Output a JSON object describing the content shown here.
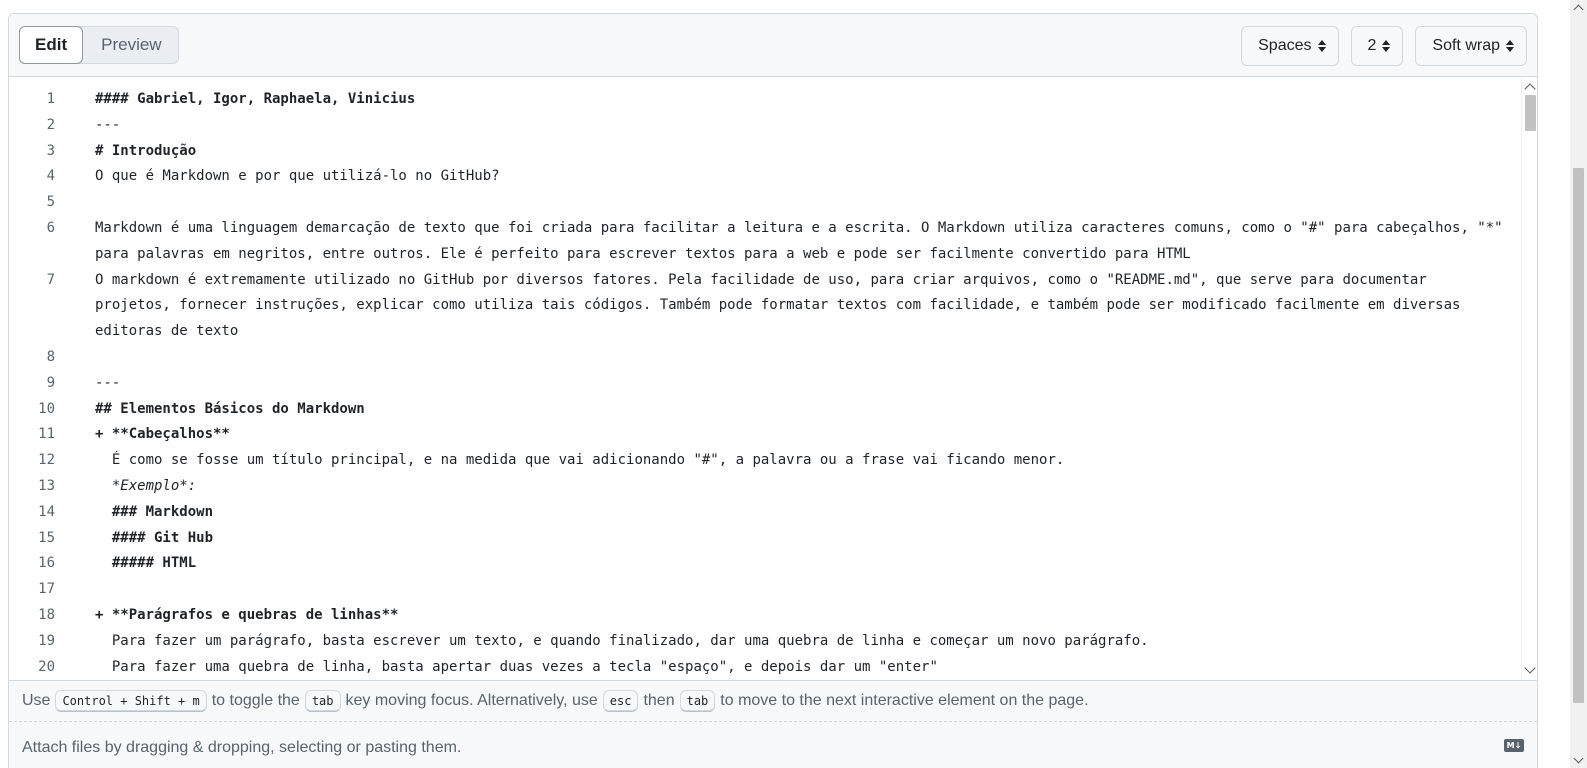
{
  "header": {
    "tabs": [
      {
        "label": "Edit",
        "active": true
      },
      {
        "label": "Preview",
        "active": false
      }
    ],
    "indent_mode": "Spaces",
    "indent_size": "2",
    "wrap_mode": "Soft wrap"
  },
  "code": {
    "lines": [
      {
        "num": "1",
        "text": "#### Gabriel, Igor, Raphaela, Vinicius",
        "style": "bold"
      },
      {
        "num": "2",
        "text": "---",
        "style": ""
      },
      {
        "num": "3",
        "text": "# Introdução",
        "style": "bold"
      },
      {
        "num": "4",
        "text": "O que é Markdown e por que utilizá-lo no GitHub?",
        "style": ""
      },
      {
        "num": "5",
        "text": "",
        "style": ""
      },
      {
        "num": "6",
        "text": "Markdown é uma linguagem demarcação de texto que foi criada para facilitar a leitura e a escrita. O Markdown utiliza caracteres comuns, como o \"#\" para cabeçalhos, \"*\" para palavras em negritos, entre outros. Ele é perfeito para escrever textos para a web e pode ser facilmente convertido para HTML",
        "style": ""
      },
      {
        "num": "7",
        "text": "O markdown é extremamente utilizado no GitHub por diversos fatores. Pela facilidade de uso, para criar arquivos, como o \"README.md\", que serve para documentar projetos, fornecer instruções, explicar como utiliza tais códigos. Também pode formatar textos com facilidade, e também pode ser modificado facilmente em diversas editoras de texto",
        "style": ""
      },
      {
        "num": "8",
        "text": "",
        "style": ""
      },
      {
        "num": "9",
        "text": "---",
        "style": ""
      },
      {
        "num": "10",
        "text": "## Elementos Básicos do Markdown",
        "style": "bold"
      },
      {
        "num": "11",
        "text": "+ **Cabeçalhos**",
        "style": "bold"
      },
      {
        "num": "12",
        "text": "  É como se fosse um título principal, e na medida que vai adicionando \"#\", a palavra ou a frase vai ficando menor.",
        "style": ""
      },
      {
        "num": "13",
        "text": "  *Exemplo*:",
        "style": "italic"
      },
      {
        "num": "14",
        "text": "  ### Markdown",
        "style": "bold"
      },
      {
        "num": "15",
        "text": "  #### Git Hub",
        "style": "bold"
      },
      {
        "num": "16",
        "text": "  ##### HTML",
        "style": "bold"
      },
      {
        "num": "17",
        "text": "",
        "style": ""
      },
      {
        "num": "18",
        "text": "+ **Parágrafos e quebras de linhas**",
        "style": "bold"
      },
      {
        "num": "19",
        "text": "  Para fazer um parágrafo, basta escrever um texto, e quando finalizado, dar uma quebra de linha e começar um novo parágrafo.",
        "style": ""
      },
      {
        "num": "20",
        "text": "  Para fazer uma quebra de linha, basta apertar duas vezes a tecla \"espaço\", e depois dar um \"enter\"",
        "style": ""
      }
    ]
  },
  "help": {
    "use": "Use",
    "kbd_toggle": "Control + Shift + m",
    "to_toggle": "to toggle the",
    "kbd_tab": "tab",
    "key_moving": "key moving focus. Alternatively, use",
    "kbd_esc": "esc",
    "then": "then",
    "kbd_tab2": "tab",
    "to_move": "to move to the next interactive element on the page."
  },
  "attach": {
    "text": "Attach files by dragging & dropping, selecting or pasting them.",
    "md_icon_label": "M↓"
  }
}
